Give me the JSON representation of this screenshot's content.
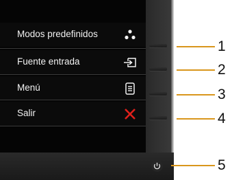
{
  "osd_menu": {
    "items": [
      {
        "label": "Modos predefinidos",
        "icon": "preset-modes-icon"
      },
      {
        "label": "Fuente entrada",
        "icon": "input-source-icon"
      },
      {
        "label": "Menú",
        "icon": "menu-icon"
      },
      {
        "label": "Salir",
        "icon": "exit-x-icon"
      }
    ]
  },
  "callouts": [
    "1",
    "2",
    "3",
    "4",
    "5"
  ],
  "colors": {
    "bezel": "#1c1c1c",
    "osd_text": "#f2f2f2",
    "exit_icon": "#e0201b",
    "leader_line": "#d9961c"
  }
}
